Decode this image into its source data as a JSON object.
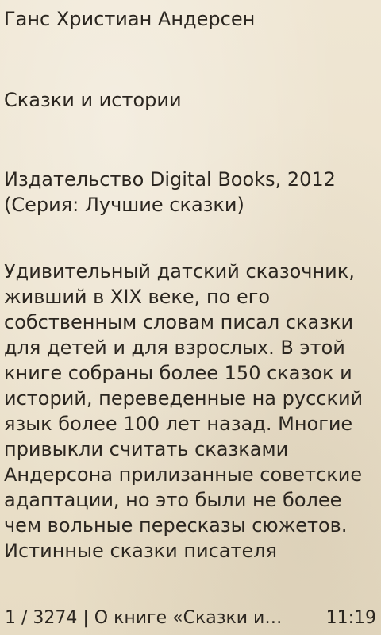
{
  "book": {
    "author": "Ганс Христиан Андерсен",
    "title": "Сказки и истории",
    "publisher_lines": [
      "Издательство Digital Books, 2012",
      "(Серия: Лучшие сказки)"
    ],
    "description_lines": [
      "Удивительный датский сказочник,",
      "живший в XIX веке, по его",
      "собственным словам писал сказки",
      "для детей и для взрослых. В этой",
      "книге собраны более 150 сказок и",
      "историй, переведенные на русский",
      "язык более 100 лет назад. Многие",
      "привыкли считать сказками",
      "Андерсона прилизанные советские",
      "адаптации, но это были не более",
      "чем вольные пересказы сюжетов.",
      "Истинные сказки писателя"
    ]
  },
  "status": {
    "position": "1 / 3274 | О книге «Сказки и…",
    "time": "11:19"
  }
}
